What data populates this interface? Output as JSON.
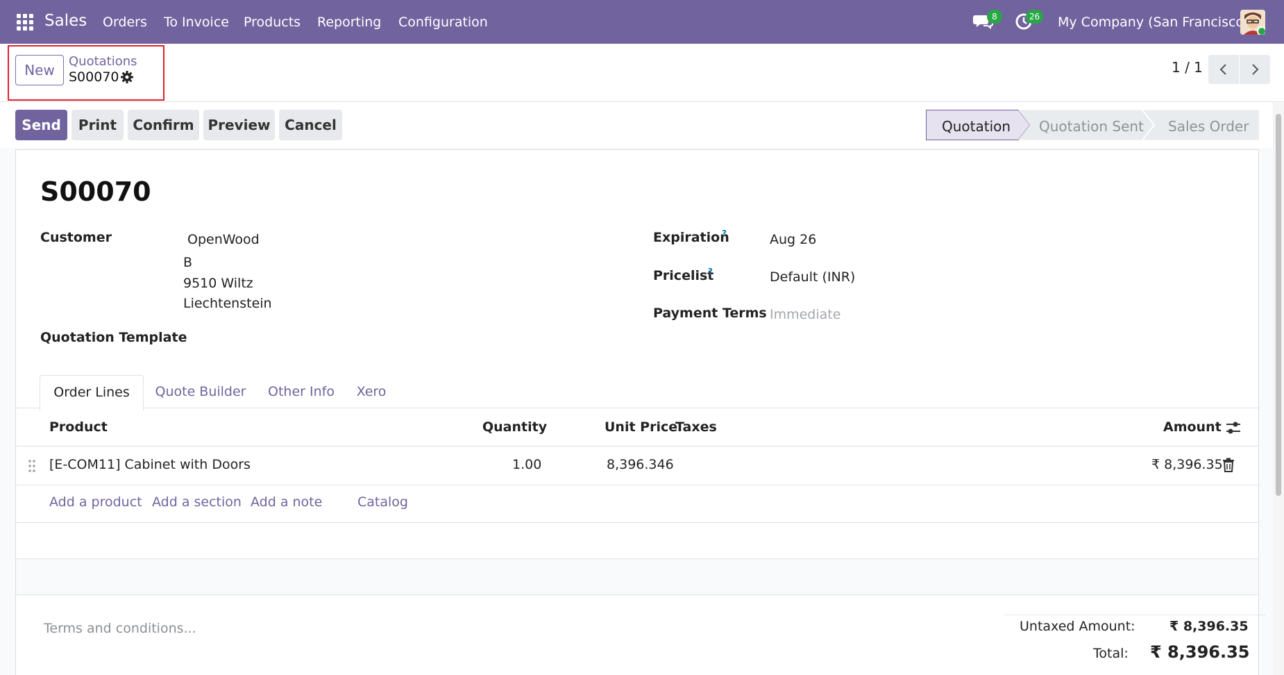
{
  "navbar": {
    "brand": "Sales",
    "menu": [
      "Orders",
      "To Invoice",
      "Products",
      "Reporting",
      "Configuration"
    ],
    "messages_count": "8",
    "activities_count": "26",
    "company": "My Company (San Francisco)"
  },
  "control_panel": {
    "new_label": "New",
    "breadcrumb_parent": "Quotations",
    "breadcrumb_current": "S00070",
    "pager": "1 / 1"
  },
  "actions": {
    "send": "Send",
    "print": "Print",
    "confirm": "Confirm",
    "preview": "Preview",
    "cancel": "Cancel"
  },
  "statusbar": {
    "steps": [
      "Quotation",
      "Quotation Sent",
      "Sales Order"
    ],
    "active": "Quotation"
  },
  "form": {
    "title": "S00070",
    "customer_label": "Customer",
    "customer_lines": [
      "OpenWood",
      "B",
      "9510 Wiltz",
      "Liechtenstein"
    ],
    "template_label": "Quotation Template",
    "expiration_label": "Expiration",
    "expiration_value": "Aug 26",
    "pricelist_label": "Pricelist",
    "pricelist_value": "Default (INR)",
    "payment_terms_label": "Payment Terms",
    "payment_terms_placeholder": "Immediate",
    "help_mark": "?"
  },
  "tabs": [
    "Order Lines",
    "Quote Builder",
    "Other Info",
    "Xero"
  ],
  "order_lines": {
    "columns": {
      "product": "Product",
      "quantity": "Quantity",
      "unit_price": "Unit Price",
      "taxes": "Taxes",
      "amount": "Amount"
    },
    "rows": [
      {
        "product": "[E-COM11] Cabinet with Doors",
        "quantity": "1.00",
        "unit_price": "8,396.346",
        "taxes": "",
        "amount": "₹ 8,396.35"
      }
    ],
    "add_links": [
      "Add a product",
      "Add a section",
      "Add a note",
      "Catalog"
    ]
  },
  "footer": {
    "terms_placeholder": "Terms and conditions...",
    "untaxed_label": "Untaxed Amount:",
    "untaxed_value": "₹ 8,396.35",
    "total_label": "Total:",
    "total_value": "₹ 8,396.35"
  },
  "colors": {
    "brand": "#71639e",
    "badge": "#28a745",
    "highlight": "#e0202e"
  }
}
